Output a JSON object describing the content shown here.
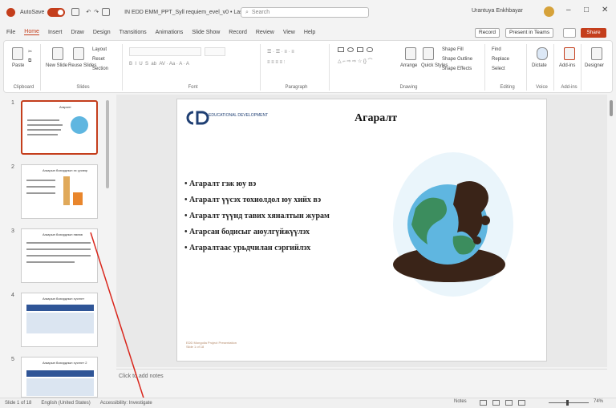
{
  "titlebar": {
    "autosave": "AutoSave",
    "toggle_state": "On",
    "doc_title": "IN EDD EMM_PPT_Syll requiem_evel_v0 • Last Modified: 1st Nov ∨",
    "search_placeholder": "Search",
    "user_name": "Urantuya Enkhbayar",
    "minimize": "–",
    "maximize": "□",
    "close": "✕"
  },
  "menu": {
    "tabs": [
      "File",
      "Home",
      "Insert",
      "Draw",
      "Design",
      "Transitions",
      "Animations",
      "Slide Show",
      "Record",
      "Review",
      "View",
      "Help"
    ],
    "active": "Home",
    "record": "Record",
    "present": "Present in Teams",
    "share": "Share"
  },
  "ribbon": {
    "groups": [
      "Clipboard",
      "Slides",
      "Font",
      "Paragraph",
      "Drawing",
      "Editing",
      "Voice",
      "Add-ins"
    ],
    "paste": "Paste",
    "new_slide": "New Slide",
    "reuse": "Reuse Slides",
    "layout": "Layout",
    "reset": "Reset",
    "section": "Section",
    "arrange": "Arrange",
    "quick_styles": "Quick Styles",
    "find": "Find",
    "replace": "Replace",
    "select": "Select",
    "dictate": "Dictate",
    "addins": "Add-ins",
    "designer": "Designer",
    "shape_fill": "Shape Fill",
    "shape_outline": "Shape Outline",
    "shape_effects": "Shape Effects"
  },
  "thumbnails": [
    {
      "num": "1",
      "title": "Агаарын бохирдол",
      "selected": true
    },
    {
      "num": "2",
      "title": "Агаарын бохирдлын эх үүсвэр",
      "selected": false
    },
    {
      "num": "3",
      "title": "Агаарын бохирдлын нөлөө",
      "selected": false
    },
    {
      "num": "4",
      "title": "Агаарын бохирдлын хүснэгт",
      "selected": false
    },
    {
      "num": "5",
      "title": "Агаарын бохирдлын хүснэгт 2",
      "selected": false
    }
  ],
  "slide": {
    "brand": "EDUCATIONAL DEVELOPMENT",
    "title": "Агаралт",
    "bullets": [
      "Агаралт гэж юу вэ",
      "Агаралт үүсэх тохиолдол юу хийх вэ",
      "Агаралт түүнд тавих хяналтын журам",
      "Агарсан бодисыг аюулгүйжүүлэх",
      "Агаралтаас урьдчилан сэргийлэх"
    ],
    "footer1": "EDD Mongolia Project Presentation",
    "footer2": "Slide 1 of 18"
  },
  "notes": {
    "placeholder": "Click to add notes"
  },
  "status": {
    "slide_count": "Slide 1 of 18",
    "language": "English (United States)",
    "accessibility": "Accessibility: Investigate",
    "notes_btn": "Notes",
    "zoom": "74%"
  },
  "colors": {
    "accent": "#c43e1c",
    "earth_blue": "#5fb6e0",
    "earth_green": "#3c8d5e",
    "oil": "#3a2418"
  }
}
